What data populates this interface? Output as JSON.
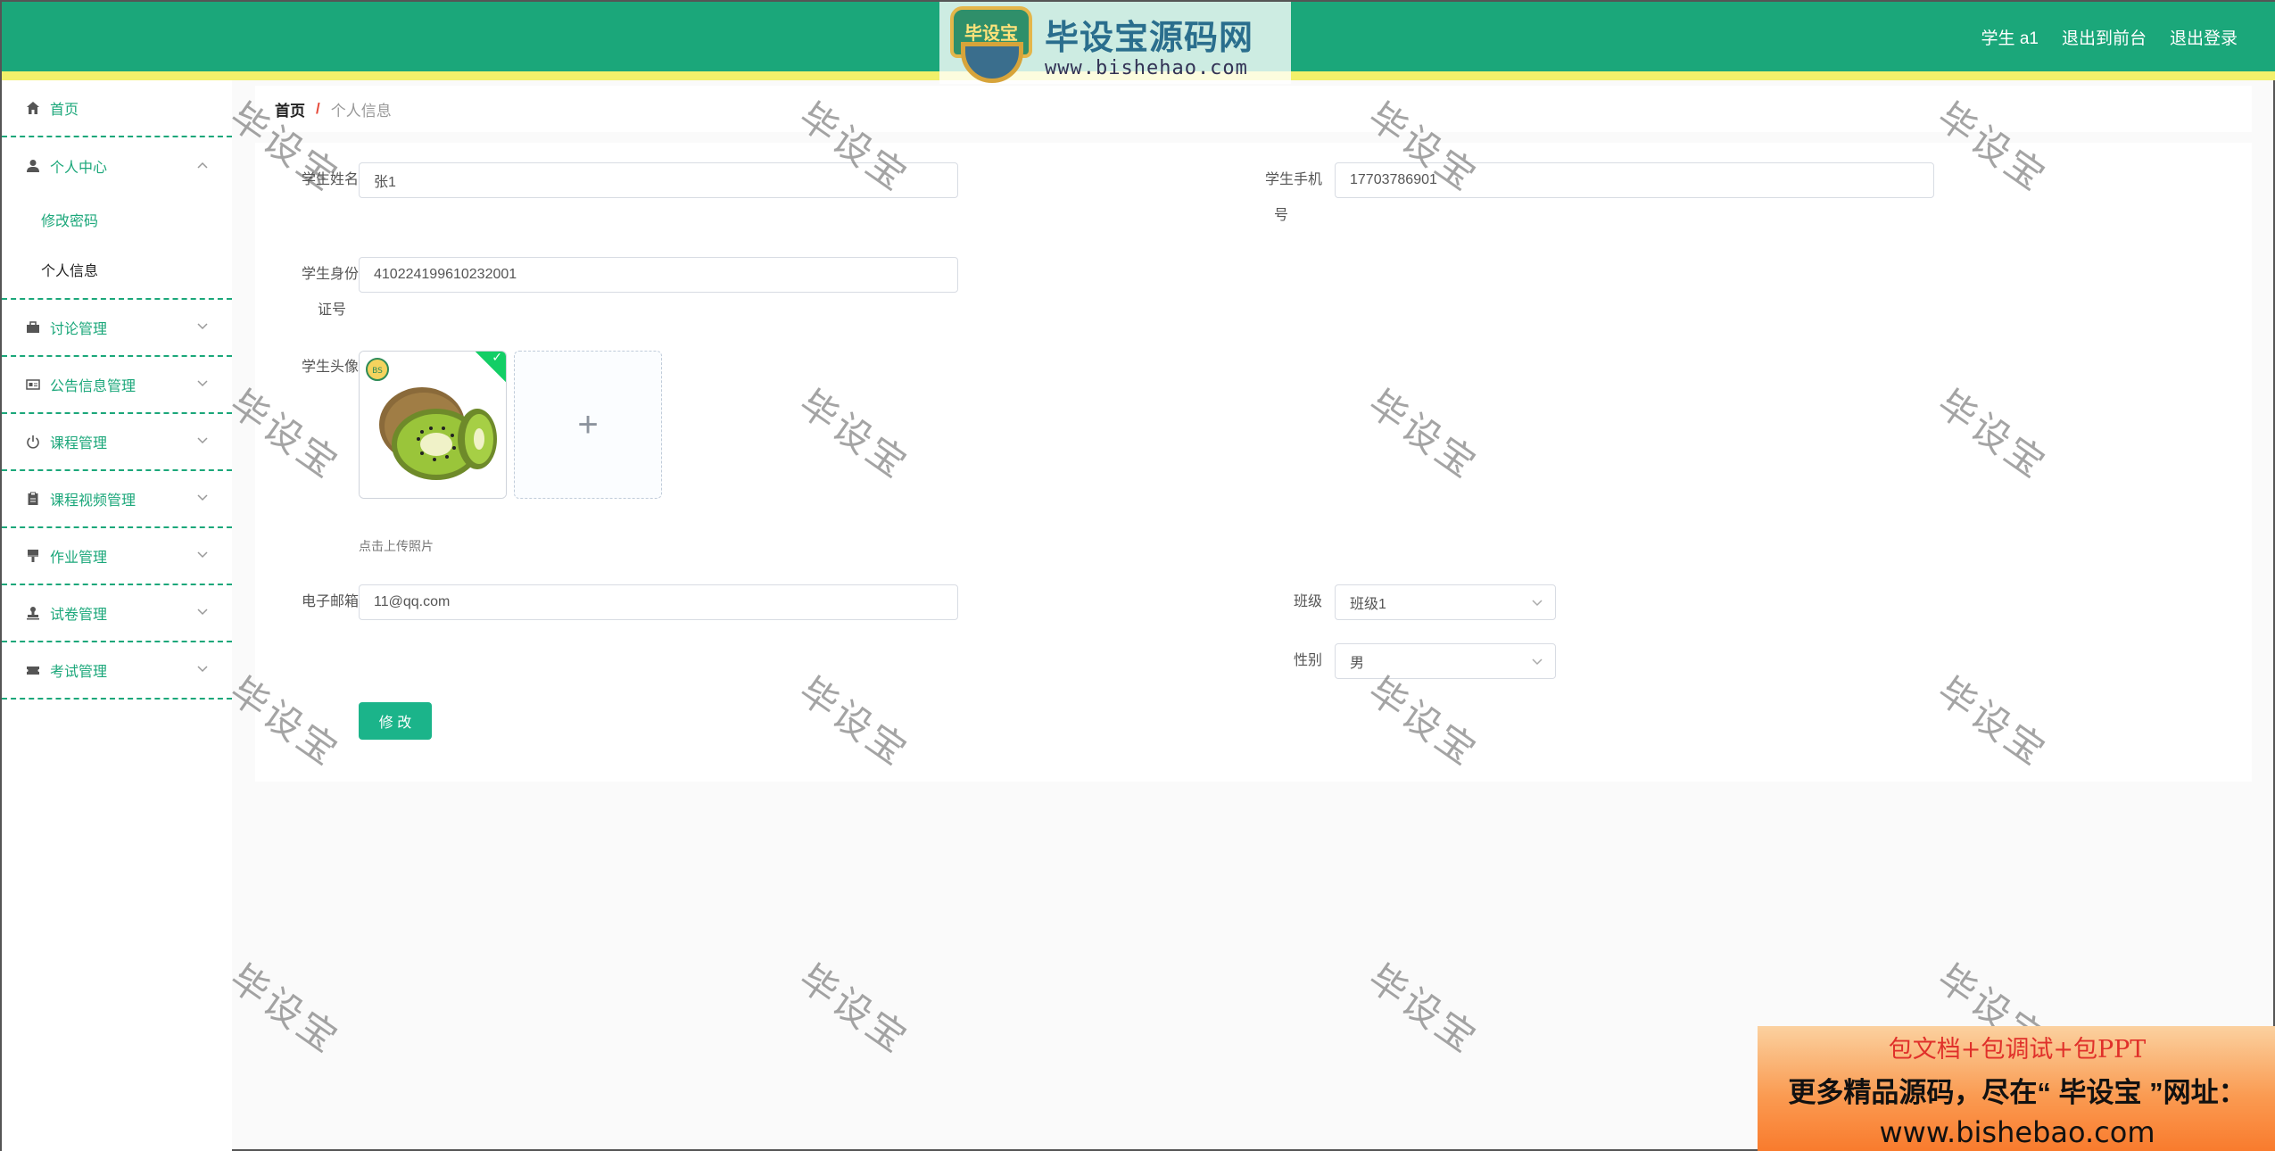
{
  "header": {
    "logo_badge": "毕设宝",
    "logo_cn": "毕设宝源码网",
    "logo_url": "www.bishehao.com",
    "user": "学生 a1",
    "back_to_front": "退出到前台",
    "logout": "退出登录",
    "colors": {
      "bar": "#1ba77a",
      "stripe": "#f2f06a"
    }
  },
  "sidebar": {
    "items": [
      {
        "label": "首页",
        "icon": "home-icon"
      },
      {
        "label": "个人中心",
        "icon": "user-icon",
        "expanded": true,
        "children": [
          {
            "label": "修改密码"
          },
          {
            "label": "个人信息",
            "active": true
          }
        ]
      },
      {
        "label": "讨论管理",
        "icon": "briefcase-icon"
      },
      {
        "label": "公告信息管理",
        "icon": "id-card-icon"
      },
      {
        "label": "课程管理",
        "icon": "power-icon"
      },
      {
        "label": "课程视频管理",
        "icon": "clipboard-icon"
      },
      {
        "label": "作业管理",
        "icon": "brush-icon"
      },
      {
        "label": "试卷管理",
        "icon": "stamp-icon"
      },
      {
        "label": "考试管理",
        "icon": "ticket-icon"
      }
    ]
  },
  "breadcrumb": {
    "home": "首页",
    "sep": "/",
    "current": "个人信息"
  },
  "form": {
    "name_label": "学生姓名",
    "name_value": "张1",
    "phone_label_1": "学生手机",
    "phone_label_2": "号",
    "phone_value": "17703786901",
    "idcard_label_1": "学生身份",
    "idcard_label_2": "证号",
    "idcard_value": "410224199610232001",
    "avatar_label": "学生头像",
    "avatar_add": "+",
    "upload_hint": "点击上传照片",
    "email_label": "电子邮箱",
    "email_value": "11@qq.com",
    "class_label": "班级",
    "class_value": "班级1",
    "gender_label": "性别",
    "gender_value": "男",
    "submit_label": "修 改"
  },
  "watermark": "毕设宝",
  "promo": {
    "line1": "包文档+包调试+包PPT",
    "line2": "更多精品源码，尽在“ 毕设宝 ”网址：",
    "line3": "www.bishebao.com"
  }
}
